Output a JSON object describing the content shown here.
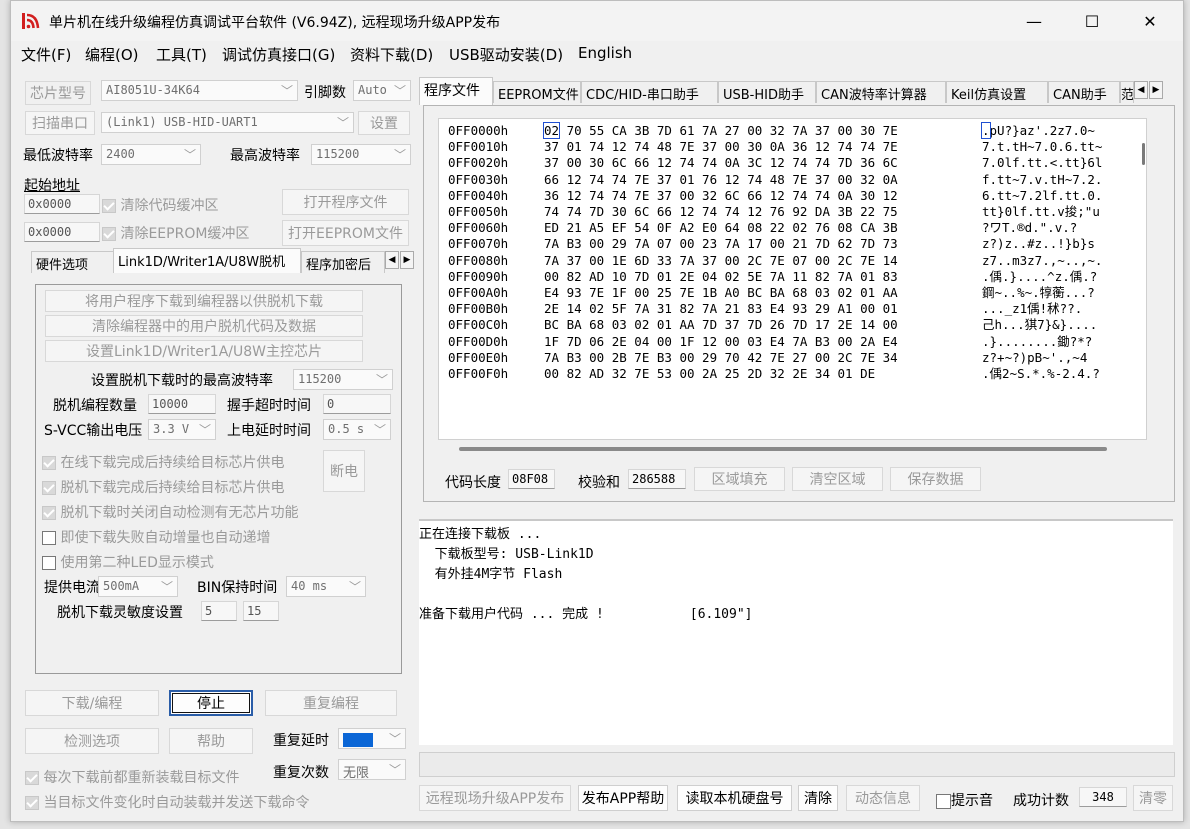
{
  "window": {
    "title": "单片机在线升级编程仿真调试平台软件 (V6.94Z), 远程现场升级APP发布",
    "min": "—",
    "max": "☐",
    "close": "✕"
  },
  "menu": [
    "文件(F)",
    "编程(O)",
    "工具(T)",
    "调试仿真接口(G)",
    "资料下载(D)",
    "USB驱动安装(D)",
    "English"
  ],
  "left": {
    "chip_label": "芯片型号",
    "chip_value": "AI8051U-34K64",
    "pins_label": "引脚数",
    "pins_value": "Auto",
    "scan_label": "扫描串口",
    "port_value": "(Link1) USB-HID-UART1",
    "settings_btn": "设置",
    "min_baud_label": "最低波特率",
    "min_baud_value": "2400",
    "max_baud_label": "最高波特率",
    "max_baud_value": "115200",
    "start_addr_label": "起始地址",
    "addr1": "0x0000",
    "clear_code_label": "清除代码缓冲区",
    "open_prog_btn": "打开程序文件",
    "addr2": "0x0000",
    "clear_eeprom_label": "清除EEPROM缓冲区",
    "open_eeprom_btn": "打开EEPROM文件",
    "tabs": [
      "硬件选项",
      "Link1D/Writer1A/U8W脱机",
      "程序加密后"
    ],
    "offline": {
      "btn1": "将用户程序下载到编程器以供脱机下载",
      "btn2": "清除编程器中的用户脱机代码及数据",
      "btn3": "设置Link1D/Writer1A/U8W主控芯片",
      "max_baud_label": "设置脱机下载时的最高波特率",
      "max_baud_value": "115200",
      "count_label": "脱机编程数量",
      "count_value": "10000",
      "handshake_label": "握手超时时间",
      "handshake_value": "0",
      "svcc_label": "S-VCC输出电压",
      "svcc_value": "3.3 V",
      "power_delay_label": "上电延时时间",
      "power_delay_value": "0.5 s",
      "cb1": "在线下载完成后持续给目标芯片供电",
      "cb2": "脱机下载完成后持续给目标芯片供电",
      "cb3": "脱机下载时关闭自动检测有无芯片功能",
      "cb4": "即使下载失败自动增量也自动递增",
      "cb5": "使用第二种LED显示模式",
      "power_off_btn": "断电",
      "current_label": "提供电流",
      "current_value": "500mA",
      "bin_label": "BIN保持时间",
      "bin_value": "40 ms",
      "sens_label": "脱机下载灵敏度设置",
      "sens1": "5",
      "sens2": "15"
    },
    "download_btn": "下载/编程",
    "stop_btn": "停止",
    "reprogram_btn": "重复编程",
    "detect_btn": "检测选项",
    "help_btn": "帮助",
    "repeat_delay_label": "重复延时",
    "repeat_delay_value": "1 秒",
    "repeat_count_label": "重复次数",
    "repeat_count_value": "无限",
    "reload_label": "每次下载前都重新装载目标文件",
    "autosend_label": "当目标文件变化时自动装载并发送下载命令"
  },
  "right": {
    "tabs": [
      "程序文件",
      "EEPROM文件",
      "CDC/HID-串口助手",
      "USB-HID助手",
      "CAN波特率计算器",
      "Keil仿真设置",
      "CAN助手",
      "范"
    ],
    "hex_rows": [
      {
        "addr": "0FF0000h",
        "bytes": "02 70 55 CA 3B 7D 61 7A 27 00 32 7A 37 00 30 7E",
        "ascii": ".pU?}az'.2z7.0~"
      },
      {
        "addr": "0FF0010h",
        "bytes": "37 01 74 12 74 48 7E 37 00 30 0A 36 12 74 74 7E",
        "ascii": "7.t.tH~7.0.6.tt~"
      },
      {
        "addr": "0FF0020h",
        "bytes": "37 00 30 6C 66 12 74 74 0A 3C 12 74 74 7D 36 6C",
        "ascii": "7.0lf.tt.<.tt}6l"
      },
      {
        "addr": "0FF0030h",
        "bytes": "66 12 74 74 7E 37 01 76 12 74 48 7E 37 00 32 0A",
        "ascii": "f.tt~7.v.tH~7.2."
      },
      {
        "addr": "0FF0040h",
        "bytes": "36 12 74 74 7E 37 00 32 6C 66 12 74 74 0A 30 12",
        "ascii": "6.tt~7.2lf.tt.0."
      },
      {
        "addr": "0FF0050h",
        "bytes": "74 74 7D 30 6C 66 12 74 74 12 76 92 DA 3B 22 75",
        "ascii": "tt}0lf.tt.v捘;\"u"
      },
      {
        "addr": "0FF0060h",
        "bytes": "ED 21 A5 EF 54 0F A2 E0 64 08 22 02 76 08 CA 3B",
        "ascii": "?ワT.®d.\".v.?"
      },
      {
        "addr": "0FF0070h",
        "bytes": "7A B3 00 29 7A 07 00 23 7A 17 00 21 7D 62 7D 73",
        "ascii": "z?)z..#z..!}b}s"
      },
      {
        "addr": "0FF0080h",
        "bytes": "7A 37 00 1E 6D 33 7A 37 00 2C 7E 07 00 2C 7E 14",
        "ascii": "z7..m3z7.,~..,~."
      },
      {
        "addr": "0FF0090h",
        "bytes": "00 82 AD 10 7D 01 2E 04 02 5E 7A 11 82 7A 01 83",
        "ascii": ".偊.}....^z.偊.?"
      },
      {
        "addr": "0FF00A0h",
        "bytes": "E4 93 7E 1F 00 25 7E 1B A0 BC BA 68 03 02 01 AA",
        "ascii": "鋼~..%~.犉蘅...?"
      },
      {
        "addr": "0FF00B0h",
        "bytes": "2E 14 02 5F 7A 31 82 7A 21 83 E4 93 29 A1 00 01",
        "ascii": "..._z1偊!秫??."
      },
      {
        "addr": "0FF00C0h",
        "bytes": "BC BA 68 03 02 01 AA 7D 37 7D 26 7D 17 2E 14 00",
        "ascii": "己h...猉7}&}...."
      },
      {
        "addr": "0FF00D0h",
        "bytes": "1F 7D 06 2E 04 00 1F 12 00 03 E4 7A B3 00 2A E4",
        "ascii": ".}........鋤?*?"
      },
      {
        "addr": "0FF00E0h",
        "bytes": "7A B3 00 2B 7E B3 00 29 70 42 7E 27 00 2C 7E 34",
        "ascii": "z?+~?)pB~'.,~4"
      },
      {
        "addr": "0FF00F0h",
        "bytes": "00 82 AD 32 7E 53 00 2A 25 2D 32 2E 34 01 DE",
        "ascii": ".偊2~S.*.%-2.4.?"
      }
    ],
    "code_len_label": "代码长度",
    "code_len_value": "08F08",
    "checksum_label": "校验和",
    "checksum_value": "286588",
    "fill_btn": "区域填充",
    "clear_area_btn": "清空区域",
    "save_btn": "保存数据",
    "log": [
      "正在连接下载板 ...",
      "  下载板型号: USB-Link1D",
      "  有外挂4M字节 Flash",
      "",
      "准备下载用户代码 ... 完成 !           [6.109\"]"
    ],
    "bottom": {
      "publish_btn": "远程现场升级APP发布",
      "publish_help_btn": "发布APP帮助",
      "read_disk_btn": "读取本机硬盘号",
      "clear_btn": "清除",
      "dyn_btn": "动态信息",
      "beep_label": "提示音",
      "success_label": "成功计数",
      "success_value": "348",
      "clear_zero_btn": "清零"
    }
  }
}
